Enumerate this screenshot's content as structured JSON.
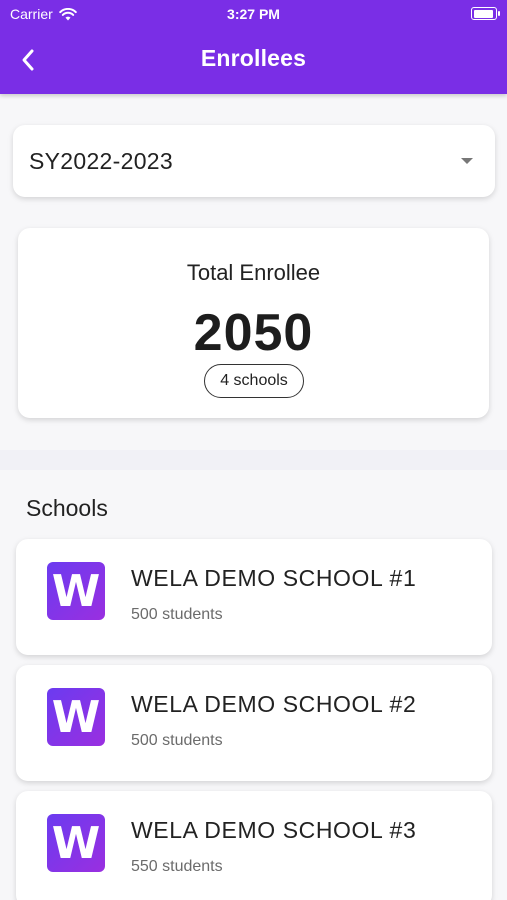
{
  "status_bar": {
    "carrier": "Carrier",
    "time": "3:27 PM"
  },
  "app_bar": {
    "title": "Enrollees",
    "back_icon": "chevron-left-icon"
  },
  "school_year_select": {
    "selected": "SY2022-2023"
  },
  "summary": {
    "label": "Total Enrollee",
    "total": "2050",
    "schools_pill": "4 schools"
  },
  "schools_section": {
    "title": "Schools",
    "items": [
      {
        "logo": "W",
        "name": "WELA DEMO SCHOOL #1",
        "students": "500 students"
      },
      {
        "logo": "W",
        "name": "WELA DEMO SCHOOL #2",
        "students": "500 students"
      },
      {
        "logo": "W",
        "name": "WELA DEMO SCHOOL #3",
        "students": "550 students"
      }
    ]
  },
  "colors": {
    "primary": "#7a2ee6",
    "logo_gradient_start": "#6b3bf0",
    "logo_gradient_end": "#9a2fe0"
  }
}
